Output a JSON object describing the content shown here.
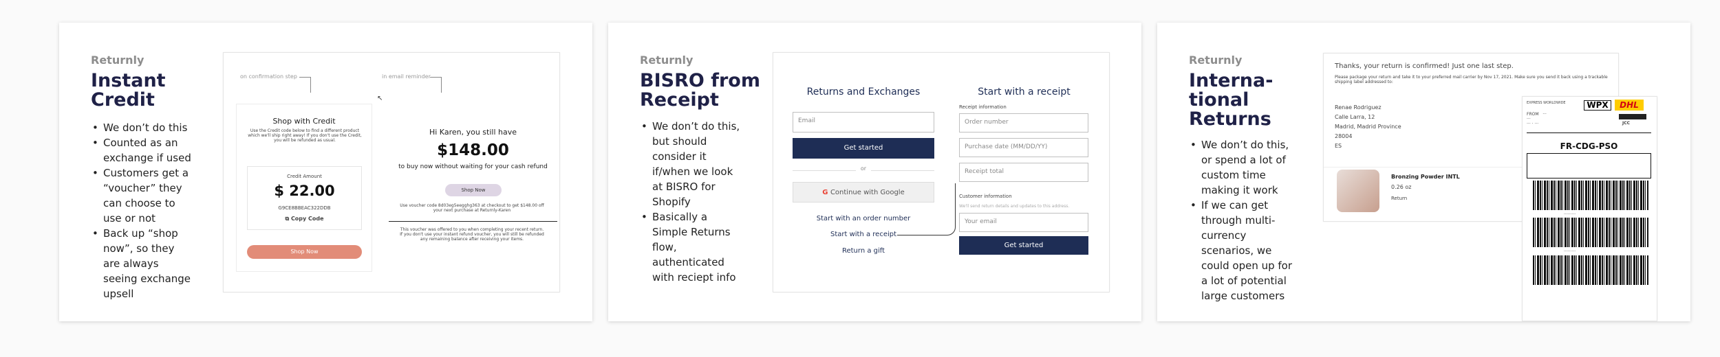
{
  "cards": [
    {
      "brand": "Returnly",
      "title_lines": [
        "Instant",
        "Credit"
      ],
      "bullets": [
        "We don’t do this",
        "Counted as an exchange if used",
        "Customers get a “voucher” they can choose to use or not",
        "Back up “shop now”, so they are always seeing exchange upsell"
      ],
      "mockup": {
        "confirmation_label": "on confirmation step",
        "email_label": "in email reminder",
        "shop_heading": "Shop with Credit",
        "shop_text": "Use the Credit code below to find a different product which we'll ship right away! If you don't use the Credit, you will be refunded as usual.",
        "credit_label": "Credit Amount",
        "credit_value": "$ 22.00",
        "credit_code": "G9CE8BBEAC322DDB",
        "copy_code": "Copy Code",
        "shop_now": "Shop Now",
        "email_greeting": "Hi Karen, you still have",
        "email_amount": "$148.00",
        "email_subtext": "to buy now without waiting for your cash refund",
        "email_shop_now": "Shop Now",
        "voucher_text": "Use voucher code 8d03eg5eegghg363 at checkout to get $148.00 off your next purchase at Returnly-Karen",
        "voucher_note": "This voucher was offered to you when completing your recent return. If you don't use your instant refund voucher, you will still be refunded any remaining balance after receiving your items."
      }
    },
    {
      "brand": "Returnly",
      "title_lines": [
        "BISRO from",
        "Receipt"
      ],
      "bullets": [
        "We don’t do this, but should consider it if/when we look at BISRO for Shopify",
        "Basically a Simple Returns flow, authenticated with reciept info"
      ],
      "mockup": {
        "left_heading": "Returns and Exchanges",
        "email_placeholder": "Email",
        "get_started": "Get started",
        "or": "or",
        "google": "Continue with Google",
        "order_link": "Start with an order number",
        "receipt_link": "Start with a receipt",
        "gift_link": "Return a gift",
        "right_heading": "Start with a receipt",
        "receipt_information": "Receipt information",
        "order_number": "Order number",
        "purchase_date": "Purchase date (MM/DD/YY)",
        "receipt_total": "Receipt total",
        "customer_information": "Customer information",
        "customer_note": "We'll send return details and updates to this address.",
        "your_email": "Your email",
        "right_get_started": "Get started"
      }
    },
    {
      "brand": "Returnly",
      "title_lines": [
        "Interna-",
        "tional",
        "Returns"
      ],
      "bullets": [
        "We don’t do this, or spend a lot of custom time making it work",
        "If we can get through multi-currency scenarios, we could open up for a lot of potential large customers"
      ],
      "mockup": {
        "confirmation": "Thanks, your return is confirmed! Just one last step.",
        "instructions": "Please package your return and take it to your preferred mail carrier by Nov 17, 2021. Make sure you send it back using a trackable shipping label addressed to:",
        "address": [
          "Renae Rodriguez",
          "Calle Larra, 12",
          "Madrid, Madrid Province",
          "28004",
          "ES"
        ],
        "product_name": "Bronzing Powder INTL",
        "product_size": "0.26 oz",
        "product_action": "Return",
        "label_top": "EXPRESS WORLDWIDE",
        "label_wpx": "WPX",
        "label_dhl": "DHL",
        "label_code": "FR-CDG-PSO",
        "label_jcc": "JCC"
      }
    }
  ]
}
